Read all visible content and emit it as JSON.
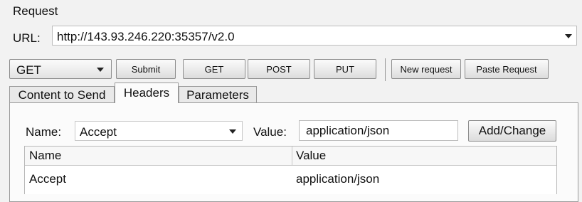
{
  "request": {
    "section_title": "Request",
    "url_label": "URL:",
    "url_value": "http://143.93.246.220:35357/v2.0"
  },
  "toolbar": {
    "method_selected": "GET",
    "submit_label": "Submit",
    "get_label": "GET",
    "post_label": "POST",
    "put_label": "PUT",
    "new_request_label": "New request",
    "paste_request_label": "Paste Request"
  },
  "tabs": [
    {
      "label": "Content to Send",
      "active": false
    },
    {
      "label": "Headers",
      "active": true
    },
    {
      "label": "Parameters",
      "active": false
    }
  ],
  "headers_panel": {
    "name_label": "Name:",
    "name_selected": "Accept",
    "value_label": "Value:",
    "value_input": "application/json",
    "add_change_label": "Add/Change",
    "table": {
      "columns": [
        "Name",
        "Value"
      ],
      "rows": [
        [
          "Accept",
          "application/json"
        ]
      ]
    }
  }
}
